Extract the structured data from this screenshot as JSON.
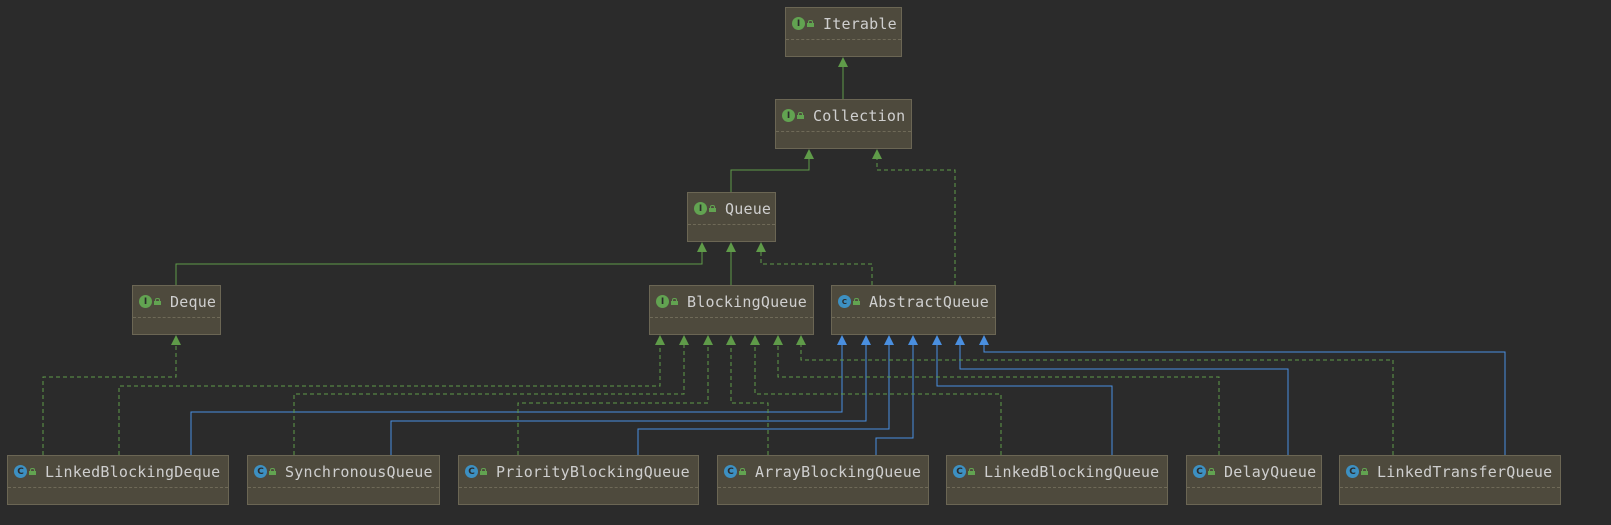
{
  "diagram": {
    "nodes": [
      {
        "id": "iterable",
        "label": "Iterable",
        "kind": "interface",
        "badge": "I",
        "icon": "interface-icon"
      },
      {
        "id": "collection",
        "label": "Collection",
        "kind": "interface",
        "badge": "I",
        "icon": "interface-icon"
      },
      {
        "id": "queue",
        "label": "Queue",
        "kind": "interface",
        "badge": "I",
        "icon": "interface-icon"
      },
      {
        "id": "deque",
        "label": "Deque",
        "kind": "interface",
        "badge": "I",
        "icon": "interface-icon"
      },
      {
        "id": "blockingqueue",
        "label": "BlockingQueue",
        "kind": "interface",
        "badge": "I",
        "icon": "interface-icon"
      },
      {
        "id": "abstractqueue",
        "label": "AbstractQueue",
        "kind": "abstract",
        "badge": "C",
        "icon": "abstract-class-icon"
      },
      {
        "id": "linkedblockingdeque",
        "label": "LinkedBlockingDeque",
        "kind": "class",
        "badge": "C",
        "icon": "class-icon"
      },
      {
        "id": "synchronousqueue",
        "label": "SynchronousQueue",
        "kind": "class",
        "badge": "C",
        "icon": "class-icon"
      },
      {
        "id": "priorityblockingqueue",
        "label": "PriorityBlockingQueue",
        "kind": "class",
        "badge": "C",
        "icon": "class-icon"
      },
      {
        "id": "arrayblockingqueue",
        "label": "ArrayBlockingQueue",
        "kind": "class",
        "badge": "C",
        "icon": "class-icon"
      },
      {
        "id": "linkedblockingqueue",
        "label": "LinkedBlockingQueue",
        "kind": "class",
        "badge": "C",
        "icon": "class-icon"
      },
      {
        "id": "delayqueue",
        "label": "DelayQueue",
        "kind": "class",
        "badge": "C",
        "icon": "class-icon"
      },
      {
        "id": "linkedtransferqueue",
        "label": "LinkedTransferQueue",
        "kind": "class",
        "badge": "C",
        "icon": "class-icon"
      }
    ],
    "edges": [
      {
        "from": "collection",
        "to": "iterable",
        "type": "extends"
      },
      {
        "from": "queue",
        "to": "collection",
        "type": "extends"
      },
      {
        "from": "abstractqueue",
        "to": "collection",
        "type": "implements"
      },
      {
        "from": "deque",
        "to": "queue",
        "type": "extends"
      },
      {
        "from": "blockingqueue",
        "to": "queue",
        "type": "extends"
      },
      {
        "from": "abstractqueue",
        "to": "queue",
        "type": "implements"
      },
      {
        "from": "linkedblockingdeque",
        "to": "deque",
        "type": "implements"
      },
      {
        "from": "linkedblockingdeque",
        "to": "blockingqueue",
        "type": "implements"
      },
      {
        "from": "linkedblockingdeque",
        "to": "abstractqueue",
        "type": "extends-class"
      },
      {
        "from": "synchronousqueue",
        "to": "blockingqueue",
        "type": "implements"
      },
      {
        "from": "synchronousqueue",
        "to": "abstractqueue",
        "type": "extends-class"
      },
      {
        "from": "priorityblockingqueue",
        "to": "blockingqueue",
        "type": "implements"
      },
      {
        "from": "priorityblockingqueue",
        "to": "abstractqueue",
        "type": "extends-class"
      },
      {
        "from": "arrayblockingqueue",
        "to": "blockingqueue",
        "type": "implements"
      },
      {
        "from": "arrayblockingqueue",
        "to": "abstractqueue",
        "type": "extends-class"
      },
      {
        "from": "linkedblockingqueue",
        "to": "blockingqueue",
        "type": "implements"
      },
      {
        "from": "linkedblockingqueue",
        "to": "abstractqueue",
        "type": "extends-class"
      },
      {
        "from": "delayqueue",
        "to": "blockingqueue",
        "type": "implements"
      },
      {
        "from": "delayqueue",
        "to": "abstractqueue",
        "type": "extends-class"
      },
      {
        "from": "linkedtransferqueue",
        "to": "blockingqueue",
        "type": "implements"
      },
      {
        "from": "linkedtransferqueue",
        "to": "abstractqueue",
        "type": "extends-class"
      }
    ],
    "colors": {
      "background": "#2b2b2b",
      "node_fill": "#4e4a3d",
      "interface_edge": "#5f9b49",
      "class_edge": "#4a8fe0"
    }
  }
}
